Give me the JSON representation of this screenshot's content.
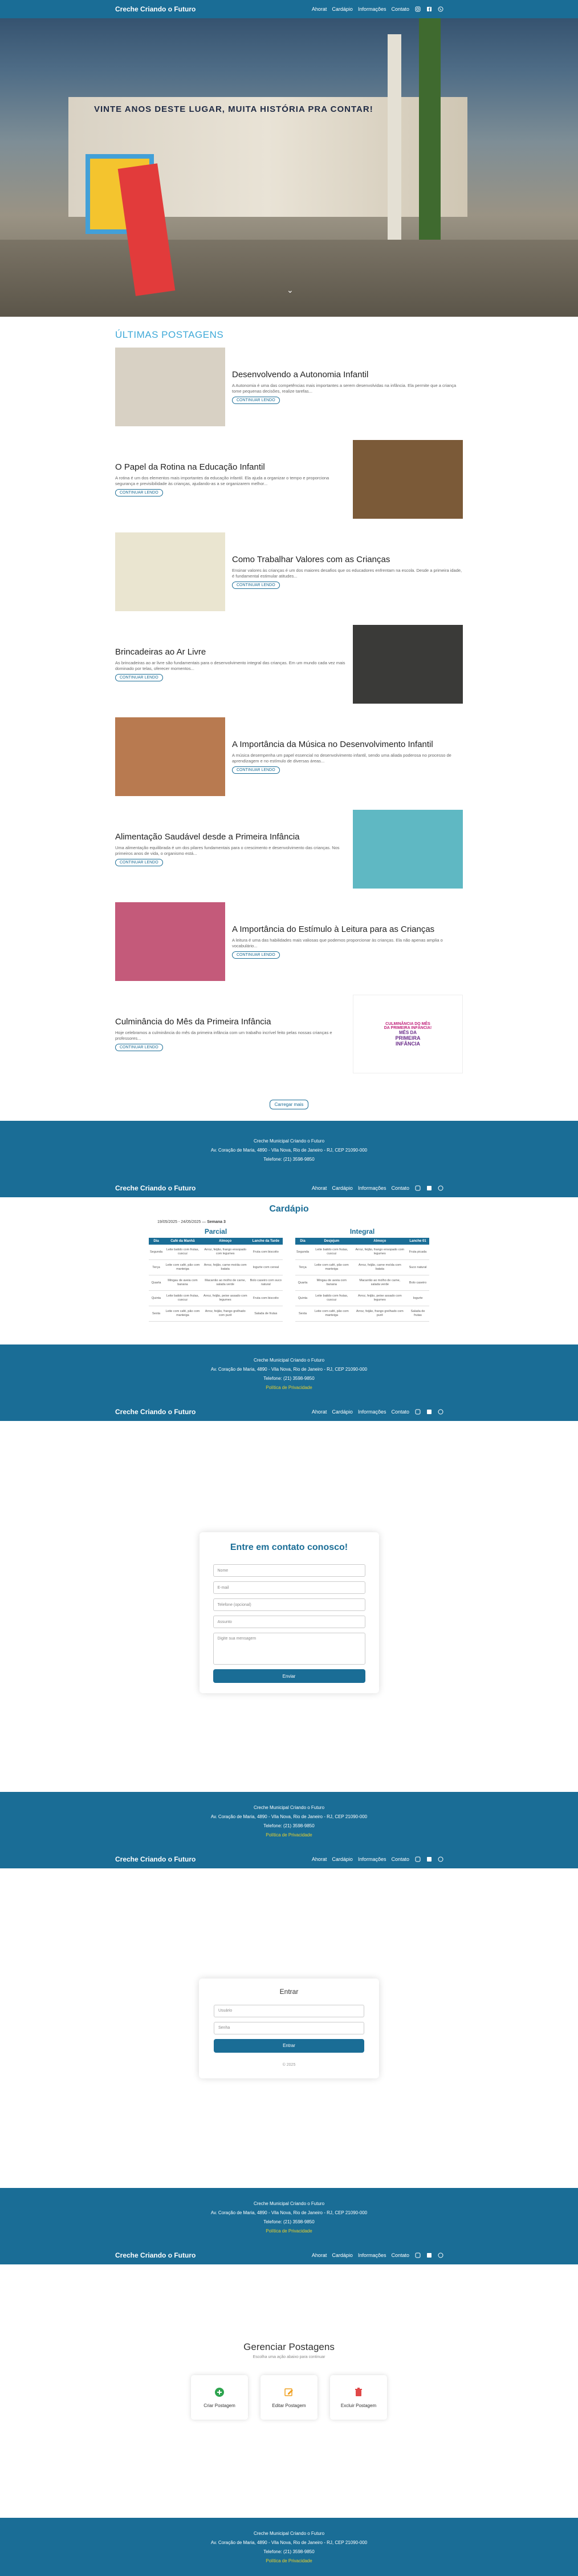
{
  "nav": {
    "brand": "Creche Criando o Futuro",
    "links": [
      "Ahorat",
      "Cardápio",
      "Informações",
      "Contato"
    ],
    "icons": [
      "instagram-icon",
      "facebook-icon",
      "whatsapp-icon"
    ]
  },
  "hero": {
    "sign": "VINTE ANOS DESTE LUGAR, MUITA HISTÓRIA PRA CONTAR!"
  },
  "posts": {
    "section_title": "ÚLTIMAS POSTAGENS",
    "read_more": "CONTINUAR LENDO",
    "load_more": "Carregar mais",
    "items": [
      {
        "title": "Desenvolvendo a Autonomia Infantil",
        "excerpt": "A Autonomia é uma das competências mais importantes a serem desenvolvidas na infância. Ela permite que a criança tome pequenas decisões, realize tarefas...",
        "color": "#d8d1c4"
      },
      {
        "title": "O Papel da Rotina na Educação Infantil",
        "excerpt": "A rotina é um dos elementos mais importantes da educação infantil. Ela ajuda a organizar o tempo e proporciona segurança e previsibilidade às crianças, ajudando-as a se organizarem melhor...",
        "color": "#7b5a38"
      },
      {
        "title": "Como Trabalhar Valores com as Crianças",
        "excerpt": "Ensinar valores às crianças é um dos maiores desafios que os educadores enfrentam na escola. Desde a primeira idade, é fundamental estimular atitudes...",
        "color": "#eae5d0"
      },
      {
        "title": "Brincadeiras ao Ar Livre",
        "excerpt": "As brincadeiras ao ar livre são fundamentais para o desenvolvimento integral das crianças. Em um mundo cada vez mais dominado por telas, oferecer momentos...",
        "color": "#3a3a38"
      },
      {
        "title": "A Importância da Música no Desenvolvimento Infantil",
        "excerpt": "A música desempenha um papel essencial no desenvolvimento infantil, sendo uma aliada poderosa no processo de aprendizagem e no estímulo de diversas áreas...",
        "color": "#b87a50"
      },
      {
        "title": "Alimentação Saudável desde a Primeira Infância",
        "excerpt": "Uma alimentação equilibrada é um dos pilares fundamentais para o crescimento e desenvolvimento das crianças. Nos primeiros anos de vida, o organismo está...",
        "color": "#5fb8c3"
      },
      {
        "title": "A Importância do Estímulo à Leitura para as Crianças",
        "excerpt": "A leitura é uma das habilidades mais valiosas que podemos proporcionar às crianças. Ela não apenas amplia o vocabulário...",
        "color": "#c45a7a"
      },
      {
        "title": "Culminância do Mês da Primeira Infância",
        "excerpt": "Hoje celebramos a culminância do mês da primeira infância com um trabalho incrível feito pelas nossas crianças e professores...",
        "color": "#ffffff"
      }
    ]
  },
  "culminancia_img": {
    "line1": "CULMINÂNCIA DO MÊS",
    "line2": "DA PRIMEIRA INFÂNCIA!",
    "line3": "MÊS DA",
    "line4": "PRIMEIRA",
    "line5": "INFÂNCIA"
  },
  "footer": {
    "l1": "Creche Municipal Criando o Futuro",
    "l2": "Av. Coração de Maria, 4890 - Vila Nova, Rio de Janeiro - RJ, CEP 21090-000",
    "l3": "Telefone: (21) 3598-9850",
    "l4": "Política de Privacidade"
  },
  "cardapio": {
    "title": "Cardápio",
    "week": "19/05/2025 - 24/05/2025",
    "week_badge": "Semana 3",
    "parcial": {
      "title": "Parcial",
      "headers": [
        "Dia",
        "Café da Manhã",
        "Almoço",
        "Lanche da Tarde"
      ],
      "rows": [
        [
          "Segunda",
          "Leite batido com frutas, cuscuz",
          "Arroz, feijão, frango ensopado com legumes",
          "Fruta com biscoito"
        ],
        [
          "Terça",
          "Leite com café, pão com manteiga",
          "Arroz, feijão, carne moída com batata",
          "Iogurte com cereal"
        ],
        [
          "Quarta",
          "Mingau de aveia com banana",
          "Macarrão ao molho de carne, salada verde",
          "Bolo caseiro com suco natural"
        ],
        [
          "Quinta",
          "Leite batido com frutas, cuscuz",
          "Arroz, feijão, peixe assado com legumes",
          "Fruta com biscoito"
        ],
        [
          "Sexta",
          "Leite com café, pão com manteiga",
          "Arroz, feijão, frango grelhado com purê",
          "Salada de frutas"
        ]
      ]
    },
    "integral": {
      "title": "Integral",
      "headers": [
        "Dia",
        "Desjejum",
        "Almoço",
        "Lanche 01"
      ],
      "rows": [
        [
          "Segunda",
          "Leite batido com frutas, cuscuz",
          "Arroz, feijão, frango ensopado com legumes",
          "Fruta picada"
        ],
        [
          "Terça",
          "Leite com café, pão com manteiga",
          "Arroz, feijão, carne moída com batata",
          "Suco natural"
        ],
        [
          "Quarta",
          "Mingau de aveia com banana",
          "Macarrão ao molho de carne, salada verde",
          "Bolo caseiro"
        ],
        [
          "Quinta",
          "Leite batido com frutas, cuscuz",
          "Arroz, feijão, peixe assado com legumes",
          "Iogurte"
        ],
        [
          "Sexta",
          "Leite com café, pão com manteiga",
          "Arroz, feijão, frango grelhado com purê",
          "Salada de frutas"
        ]
      ]
    }
  },
  "contact": {
    "title": "Entre em contato conosco!",
    "fields": [
      "Nome",
      "E-mail",
      "Telefone (opcional)",
      "Assunto"
    ],
    "message": "Digite sua mensagem",
    "submit": "Enviar"
  },
  "login": {
    "title": "Entrar",
    "user": "Usuário",
    "password": "Senha",
    "submit": "Entrar",
    "hint": "© 2025"
  },
  "manage": {
    "title": "Gerenciar Postagens",
    "subtitle": "Escolha uma ação abaixo para continuar",
    "cards": [
      {
        "label": "Criar Postagem",
        "color": "#2ea44f"
      },
      {
        "label": "Editar Postagem",
        "color": "#f0a020"
      },
      {
        "label": "Excluir Postagem",
        "color": "#e04848"
      }
    ]
  }
}
